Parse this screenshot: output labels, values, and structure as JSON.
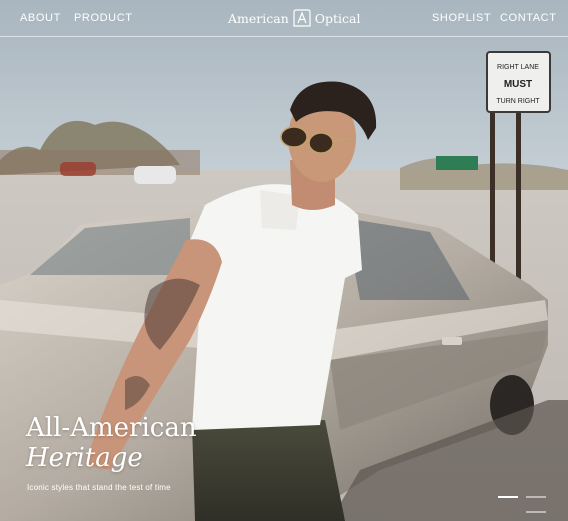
{
  "nav": {
    "about": "ABOUT",
    "product": "PRODUCT",
    "shoplist": "SHOPLIST",
    "contact": "CONTACT"
  },
  "brand": {
    "left": "American",
    "right": "Optical",
    "icon": "ao-monogram-icon"
  },
  "hero": {
    "title_line1": "All-American",
    "title_line2": "Heritage",
    "subtitle": "Iconic styles that stand the test of time",
    "sign_lines": [
      "RIGHT LANE",
      "MUST",
      "TURN RIGHT"
    ]
  },
  "slider": {
    "count": 3,
    "active": 1
  },
  "colors": {
    "text": "#ffffff",
    "sky": "#cfd6db",
    "car": "#bfb7ad"
  }
}
